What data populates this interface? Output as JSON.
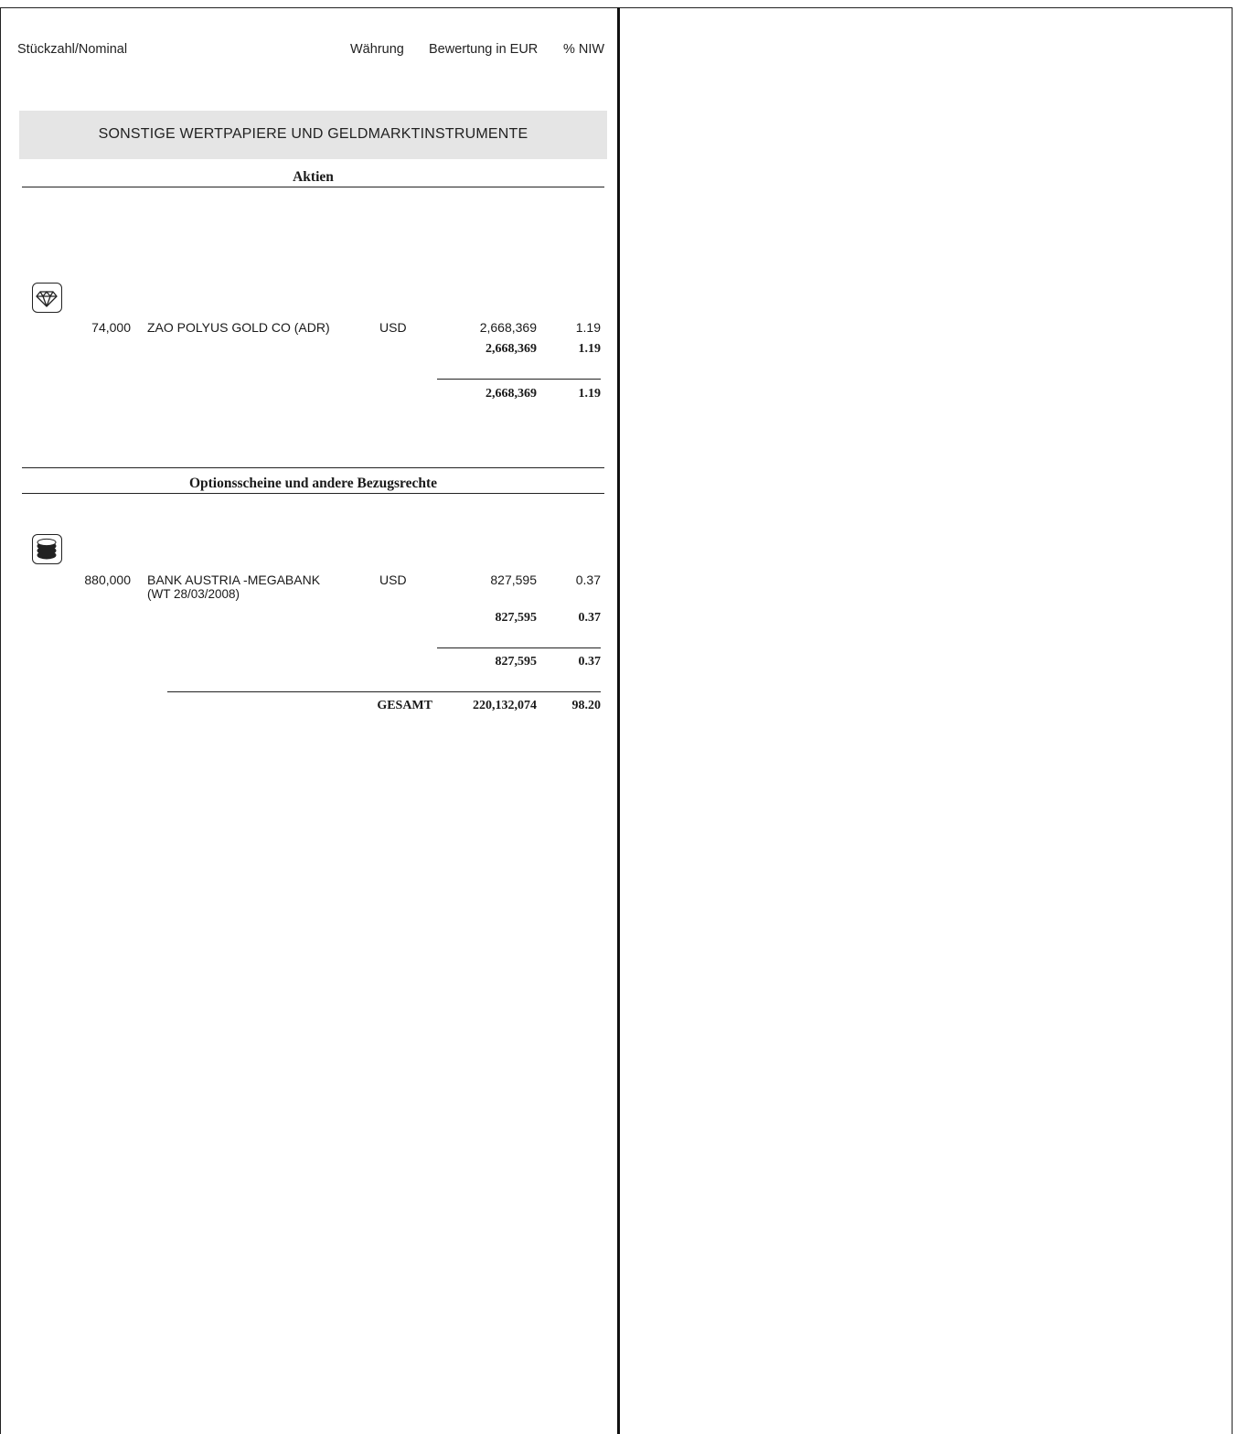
{
  "header": {
    "nominal": "Stückzahl/Nominal",
    "currency": "Währung",
    "valuation": "Bewertung in EUR",
    "nav_pct": "% NIW"
  },
  "section": {
    "title": "SONSTIGE WERTPAPIERE UND GELDMARKTINSTRUMENTE"
  },
  "aktien": {
    "heading": "Aktien",
    "icon": "diamond-icon",
    "row": {
      "quantity": "74,000",
      "name": "ZAO POLYUS GOLD CO (ADR)",
      "currency": "USD",
      "value": "2,668,369",
      "pct": "1.19"
    },
    "subtotal": {
      "value": "2,668,369",
      "pct": "1.19"
    },
    "total": {
      "value": "2,668,369",
      "pct": "1.19"
    }
  },
  "options": {
    "heading": "Optionsscheine und andere Bezugsrechte",
    "icon": "coins-icon",
    "row": {
      "quantity": "880,000",
      "name_line1": "BANK AUSTRIA -MEGABANK",
      "name_line2": "(WT 28/03/2008)",
      "currency": "USD",
      "value": "827,595",
      "pct": "0.37"
    },
    "subtotal": {
      "value": "827,595",
      "pct": "0.37"
    },
    "total": {
      "value": "827,595",
      "pct": "0.37"
    }
  },
  "grand_total": {
    "label": "GESAMT",
    "value": "220,132,074",
    "pct": "98.20"
  }
}
